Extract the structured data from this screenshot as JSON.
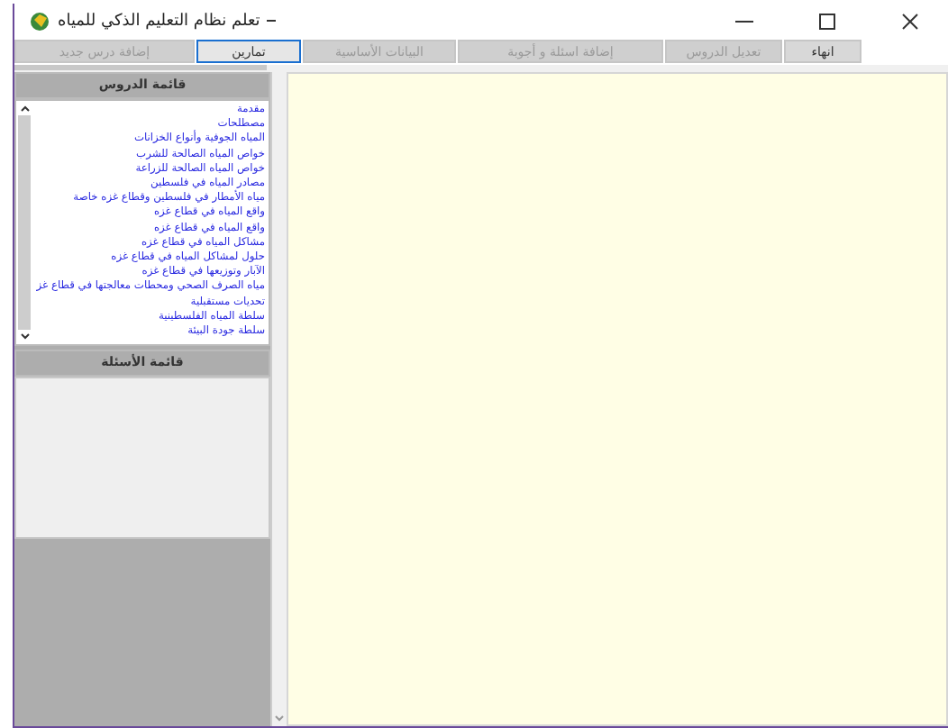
{
  "window": {
    "title": "تعلم نظام التعليم الذكي للمياه"
  },
  "toolbar": [
    {
      "label": "انهاء",
      "disabled": false,
      "selected": false
    },
    {
      "label": "تعديل الدروس",
      "disabled": true,
      "selected": false
    },
    {
      "label": "إضافة اسئلة و أجوبة",
      "disabled": true,
      "selected": false
    },
    {
      "label": "البيانات الأساسية",
      "disabled": true,
      "selected": false
    },
    {
      "label": "تمارين",
      "disabled": false,
      "selected": true
    },
    {
      "label": "إضافة درس جديد",
      "disabled": true,
      "selected": false
    }
  ],
  "lessons": {
    "title": "قائمة الدروس",
    "items": [
      "مقدمة",
      "مصطلحات",
      "المياه الجوفية وأنواع الخزانات",
      "خواص المياه الصالحة للشرب",
      "خواص المياه الصالحة للزراعة",
      "مصادر المياه في فلسطين",
      "مياه الأمطار في فلسطين وقطاع غزه خاصة",
      "واقع المياه في قطاع غزه",
      "واقع المياه في قطاع غزه",
      "مشاكل المياه في قطاع غزه",
      "حلول لمشاكل المياه في قطاع غزه",
      "الآبار وتوزيعها في قطاع غزه",
      "مياه الصرف الصحي ومحطات معالجتها في قطاع غز",
      "تحديات مستقبلية",
      "سلطة المياه الفلسطينية",
      "سلطة جودة البيئة"
    ]
  },
  "questions": {
    "title": "قائمة الأسئلة"
  }
}
